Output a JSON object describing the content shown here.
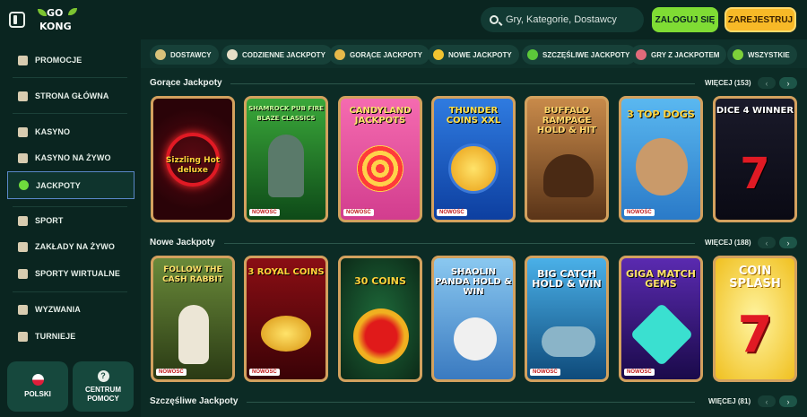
{
  "header": {
    "logo_top": "GO",
    "logo_bottom": "KONG",
    "search_placeholder": "Gry, Kategorie, Dostawcy",
    "login_label": "ZALOGUJ SIĘ",
    "register_label": "ZAREJESTRUJ"
  },
  "sidebar": {
    "items": [
      {
        "label": "PROMOCJE",
        "icon": "gift-icon"
      },
      {
        "label": "STRONA GŁÓWNA",
        "icon": "home-icon"
      },
      {
        "label": "KASYNO",
        "icon": "slot-icon"
      },
      {
        "label": "KASYNO NA ŻYWO",
        "icon": "live-casino-icon"
      },
      {
        "label": "JACKPOTY",
        "icon": "clover-icon"
      },
      {
        "label": "SPORT",
        "icon": "ball-icon"
      },
      {
        "label": "ZAKŁADY NA ŻYWO",
        "icon": "live-icon"
      },
      {
        "label": "SPORTY WIRTUALNE",
        "icon": "virtual-sports-icon"
      },
      {
        "label": "WYZWANIA",
        "icon": "challenge-icon"
      },
      {
        "label": "TURNIEJE",
        "icon": "trophy-icon"
      }
    ],
    "language_label": "POLSKI",
    "help_label_1": "CENTRUM",
    "help_label_2": "POMOCY",
    "help_glyph": "?"
  },
  "categories": [
    {
      "label": "DOSTAWCY",
      "color": "#d8c27a"
    },
    {
      "label": "CODZIENNE JACKPOTY",
      "color": "#e8e0c8"
    },
    {
      "label": "GORĄCE JACKPOTY",
      "color": "#e6b94a"
    },
    {
      "label": "NOWE JACKPOTY",
      "color": "#f2c430"
    },
    {
      "label": "SZCZĘŚLIWE JACKPOTY",
      "color": "#5cc83a"
    },
    {
      "label": "GRY Z JACKPOTEM",
      "color": "#e06a7a"
    },
    {
      "label": "WSZYSTKIE",
      "color": "#7ed13a"
    }
  ],
  "sections": [
    {
      "title": "Gorące Jackpoty",
      "more": "WIĘCEJ (153)",
      "games": [
        {
          "title": "Sizzling Hot deluxe",
          "new": false
        },
        {
          "title": "SHAMROCK PUB FIRE BLAZE CLASSICS",
          "new": true
        },
        {
          "title": "CANDYLAND JACKPOTS",
          "new": true
        },
        {
          "title": "THUNDER COINS XXL",
          "new": true
        },
        {
          "title": "BUFFALO RAMPAGE HOLD & HIT",
          "new": false
        },
        {
          "title": "3 TOP DOGS",
          "new": true
        },
        {
          "title": "DICE 4 WINNER",
          "new": false
        }
      ]
    },
    {
      "title": "Nowe Jackpoty",
      "more": "WIĘCEJ (188)",
      "games": [
        {
          "title": "FOLLOW THE CASH RABBIT",
          "new": true
        },
        {
          "title": "3 ROYAL COINS",
          "new": true
        },
        {
          "title": "30 COINS",
          "new": false
        },
        {
          "title": "SHAOLIN PANDA HOLD & WIN",
          "new": false
        },
        {
          "title": "BIG CATCH HOLD & WIN",
          "new": true
        },
        {
          "title": "GIGA MATCH GEMS",
          "new": true
        },
        {
          "title": "COIN SPLASH",
          "new": false
        }
      ]
    },
    {
      "title": "Szczęśliwe Jackpoty",
      "more": "WIĘCEJ (81)",
      "games": []
    }
  ],
  "badge_label": "NOWOŚĆ",
  "nav": {
    "prev": "‹",
    "next": "›"
  }
}
